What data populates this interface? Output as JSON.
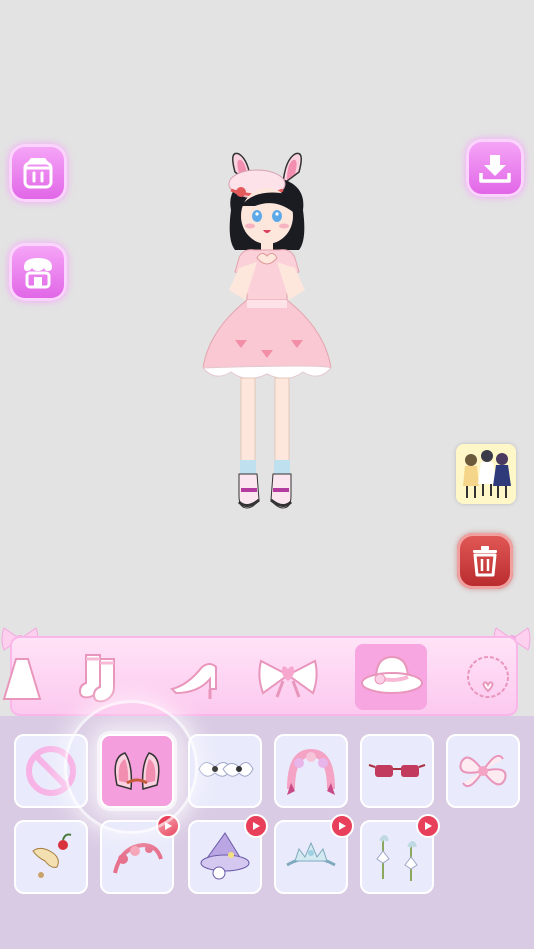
{
  "app": {
    "side_buttons": [
      {
        "name": "closet-button",
        "icon": "wardrobe-icon"
      },
      {
        "name": "shop-button",
        "icon": "store-icon"
      },
      {
        "name": "download-button",
        "icon": "download-icon"
      }
    ],
    "delete_button": {
      "icon": "trash-icon",
      "color": "#c8383a"
    },
    "accent": "#f7a6e2"
  },
  "categories": [
    {
      "id": "dress",
      "icon": "dress-icon",
      "active": false
    },
    {
      "id": "socks",
      "icon": "socks-icon",
      "active": false
    },
    {
      "id": "shoes",
      "icon": "high-heel-icon",
      "active": false
    },
    {
      "id": "bow",
      "icon": "bow-icon",
      "active": false
    },
    {
      "id": "hat",
      "icon": "hat-icon",
      "active": true
    },
    {
      "id": "necklace",
      "icon": "necklace-icon",
      "active": false
    }
  ],
  "items": [
    {
      "id": "none",
      "icon": "none-icon",
      "selected": false,
      "ad": false
    },
    {
      "id": "bunny-ears",
      "icon": "bunny-ears-icon",
      "selected": true,
      "ad": false
    },
    {
      "id": "bow-clips",
      "icon": "bow-clips-icon",
      "selected": false,
      "ad": false
    },
    {
      "id": "flower-headband",
      "icon": "flower-headband-icon",
      "selected": false,
      "ad": false
    },
    {
      "id": "sunglasses",
      "icon": "sunglasses-icon",
      "selected": false,
      "ad": false
    },
    {
      "id": "ribbon-flower",
      "icon": "ribbon-flower-icon",
      "selected": false,
      "ad": false
    },
    {
      "id": "cherry-clip",
      "icon": "cherry-clip-icon",
      "selected": false,
      "ad": false
    },
    {
      "id": "berry-headband",
      "icon": "berry-headband-icon",
      "selected": false,
      "ad": true
    },
    {
      "id": "witch-hat",
      "icon": "witch-hat-icon",
      "selected": false,
      "ad": true
    },
    {
      "id": "tiara",
      "icon": "tiara-icon",
      "selected": false,
      "ad": true
    },
    {
      "id": "lily-pins",
      "icon": "lily-pins-icon",
      "selected": false,
      "ad": true
    }
  ]
}
